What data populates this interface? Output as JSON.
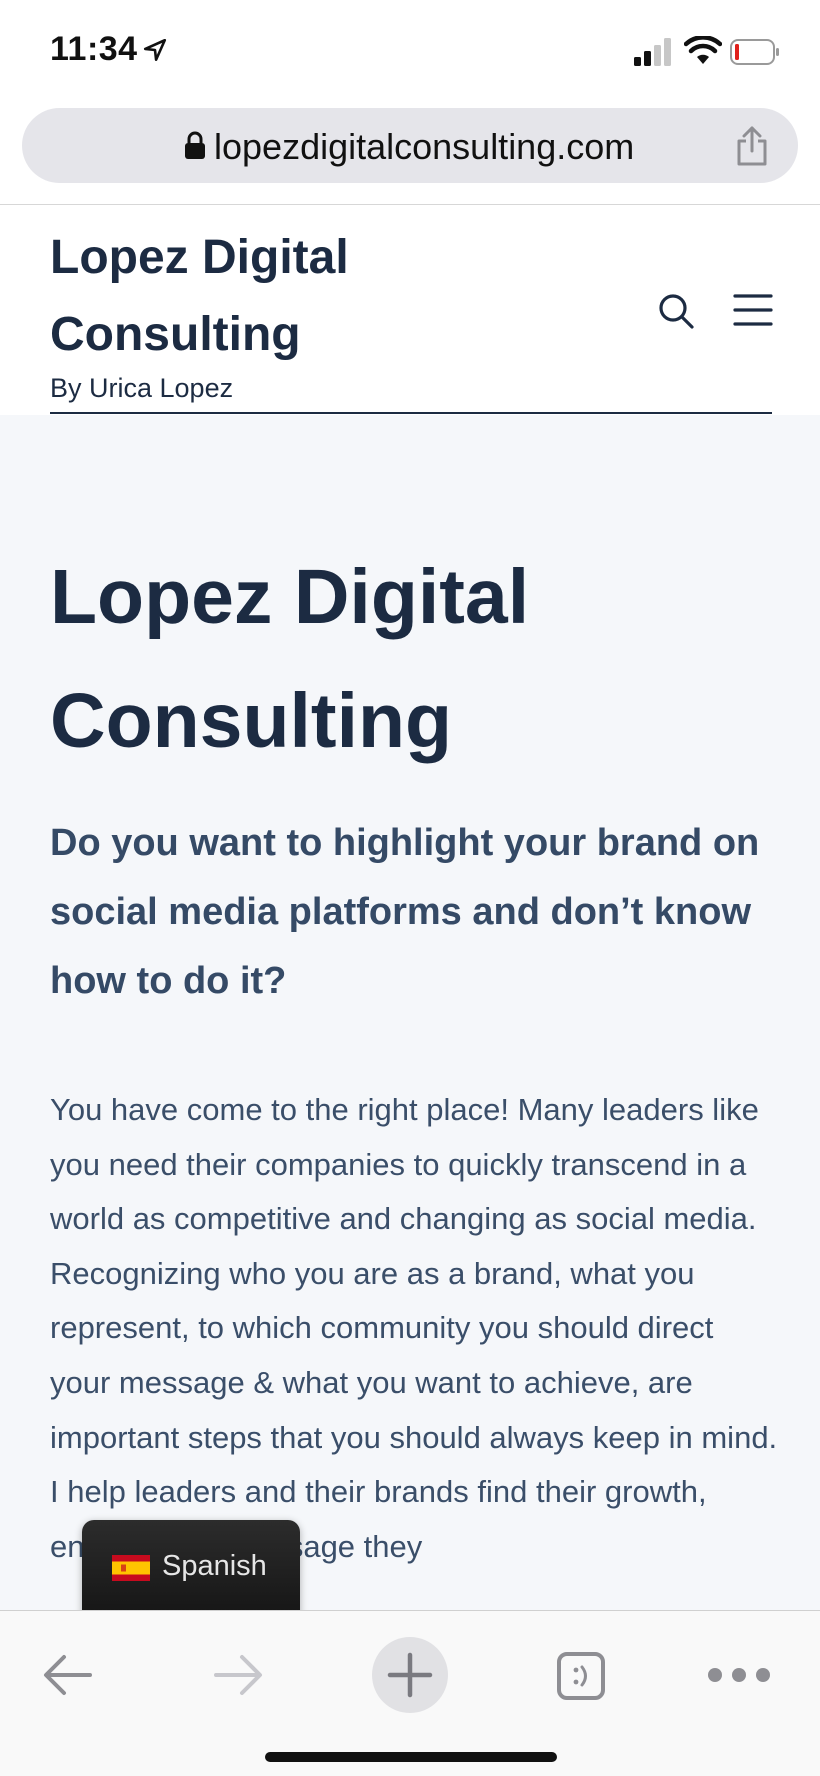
{
  "status_bar": {
    "time": "11:34"
  },
  "browser": {
    "url": "lopezdigitalconsulting.com"
  },
  "site": {
    "title": "Lopez Digital Consulting",
    "byline": "By Urica Lopez"
  },
  "article": {
    "title": "Lopez Digital Consulting",
    "subheading": "Do you want to highlight your brand on social media platforms and don’t know how to do it?",
    "body": "You have come to the right place! Many leaders like you need their companies to quickly transcend in a world as competitive and changing as social media. Recognizing who you are as a brand, what you represent, to which community you should direct your message & what you want to achieve, are important steps that you should always keep in mind. I help leaders and their brands find their growth, enhance the message they"
  },
  "translate_widget": {
    "language": "Spanish"
  },
  "icons": {
    "location": "location-arrow-icon",
    "signal": "cellular-signal-icon",
    "wifi": "wifi-icon",
    "battery": "battery-low-icon",
    "lock": "lock-icon",
    "share": "share-icon",
    "search": "search-icon",
    "menu": "hamburger-menu-icon",
    "back": "back-arrow-icon",
    "forward": "forward-arrow-icon",
    "new_tab": "plus-icon",
    "tabs": "tabs-icon",
    "more": "more-dots-icon"
  },
  "colors": {
    "heading": "#1c2b42",
    "subheading": "#354a66",
    "body_text": "#3a4e69",
    "content_background": "#f5f7fa",
    "battery_low": "#e0201b"
  }
}
